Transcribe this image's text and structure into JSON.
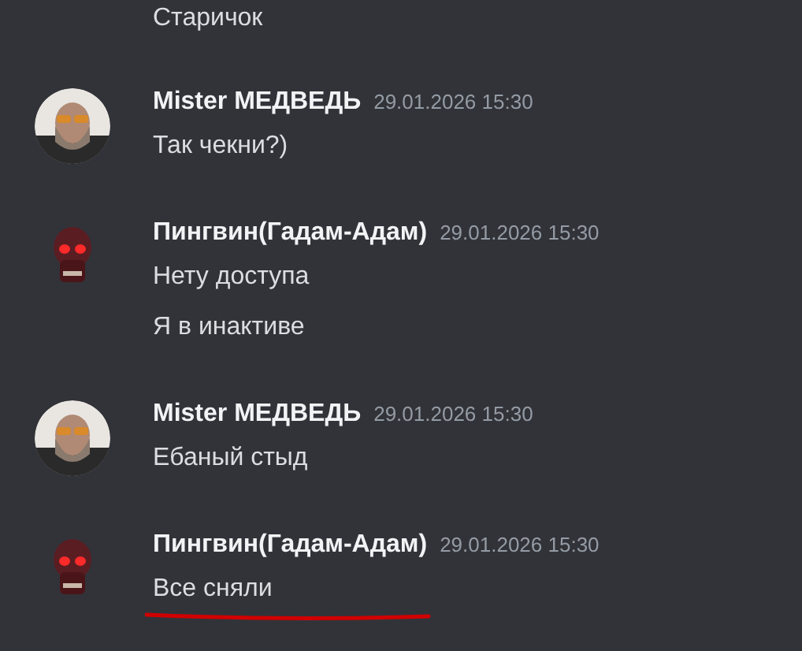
{
  "previous_line": "Старичок",
  "messages": [
    {
      "author": "Mister МЕДВЕДЬ",
      "timestamp": "29.01.2026 15:30",
      "kind": "bear",
      "lines": [
        "Так чекни?)"
      ],
      "underlined": false
    },
    {
      "author": "Пингвин(Гадам-Адам)",
      "timestamp": "29.01.2026 15:30",
      "kind": "skull",
      "lines": [
        "Нету доступа",
        "Я в инактиве"
      ],
      "underlined": false
    },
    {
      "author": "Mister МЕДВЕДЬ",
      "timestamp": "29.01.2026 15:30",
      "kind": "bear",
      "lines": [
        "Ебаный стыд"
      ],
      "underlined": false
    },
    {
      "author": "Пингвин(Гадам-Адам)",
      "timestamp": "29.01.2026 15:30",
      "kind": "skull",
      "lines": [
        "Все сняли"
      ],
      "underlined": true
    }
  ]
}
